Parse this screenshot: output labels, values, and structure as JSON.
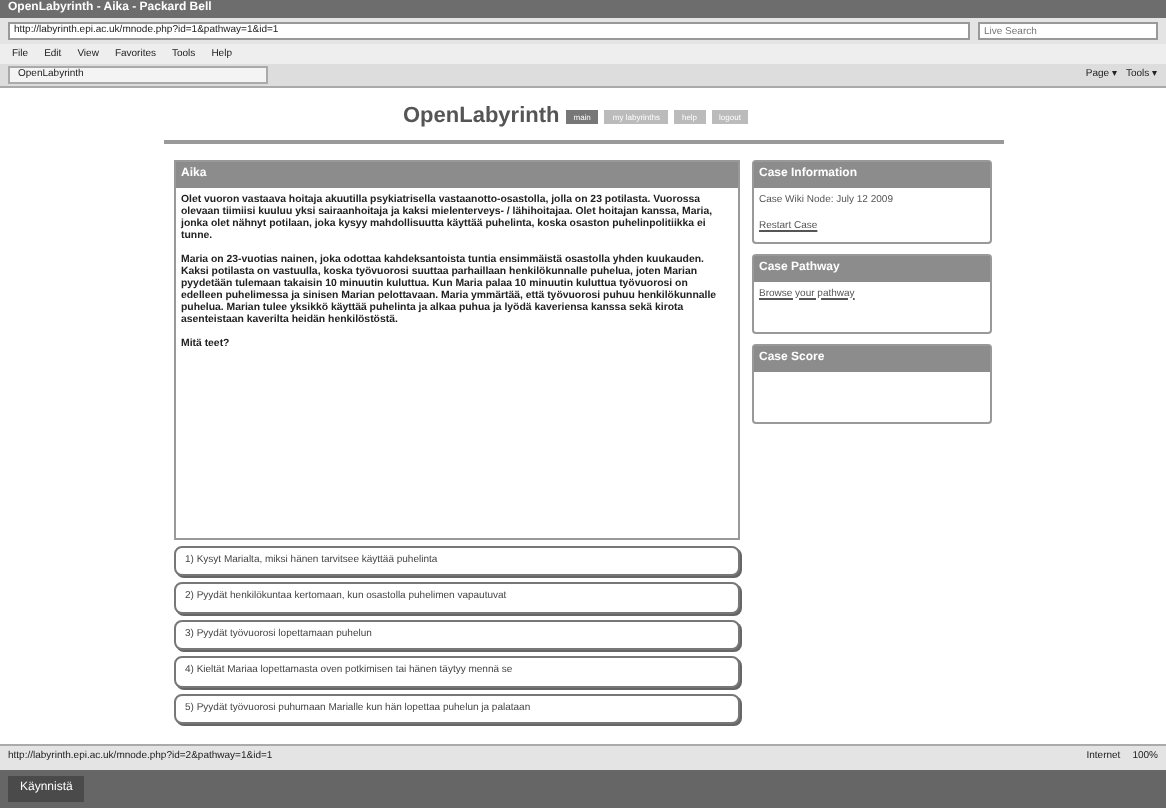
{
  "window": {
    "title": "OpenLabyrinth - Aika - Packard Bell"
  },
  "browser": {
    "address": "http://labyrinth.epi.ac.uk/mnode.php?id=1&pathway=1&id=1",
    "search_placeholder": "Live Search",
    "menu": [
      "File",
      "Edit",
      "View",
      "Favorites",
      "Tools",
      "Help"
    ],
    "tab": "OpenLabyrinth",
    "tools": [
      "Page ▾",
      "Tools ▾"
    ]
  },
  "site": {
    "logo": "OpenLabyrinth",
    "nav": [
      {
        "label": "main",
        "selected": true
      },
      {
        "label": "my labyrinths",
        "selected": false
      },
      {
        "label": "help",
        "selected": false
      },
      {
        "label": "logout",
        "selected": false
      }
    ]
  },
  "node": {
    "title": "Aika",
    "paragraphs": [
      "Olet vuoron vastaava hoitaja akuutilla psykiatrisella vastaanotto-osastolla, jolla on 23 potilasta. Vuorossa olevaan tiimiisi kuuluu yksi sairaanhoitaja ja kaksi mielenterveys- / lähihoitajaa. Olet hoitajan kanssa, Maria, jonka olet nähnyt potilaan, joka kysyy mahdollisuutta käyttää puhelinta, koska osaston puhelinpolitiikka ei tunne.",
      "Maria on 23-vuotias nainen, joka odottaa kahdeksantoista tuntia ensimmäistä osastolla yhden kuukauden. Kaksi potilasta on vastuulla, koska työvuorosi suuttaa parhaillaan henkilökunnalle puhelua, joten Marian pyydetään tulemaan takaisin 10 minuutin kuluttua. Kun Maria palaa 10 minuutin kuluttua työvuorosi on edelleen puhelimessa ja sinisen Marian pelottavaan. Maria ymmärtää, että työvuorosi puhuu henkilökunnalle puhelua. Marian tulee yksikkö käyttää puhelinta ja alkaa puhua ja lyödä kaveriensa kanssa sekä kirota asenteistaan kaverilta heidän henkilöstöstä.",
      "Mitä teet?"
    ],
    "options": [
      "1) Kysyt Marialta, miksi hänen tarvitsee käyttää puhelinta",
      "2) Pyydät henkilökuntaa kertomaan, kun osastolla puhelimen vapautuvat",
      "3) Pyydät työvuorosi lopettamaan puhelun",
      "4) Kieltät Mariaa lopettamasta oven potkimisen tai hänen täytyy mennä se",
      "5) Pyydät työvuorosi puhumaan Marialle kun hän lopettaa puhelun ja palataan"
    ]
  },
  "sidebar": [
    {
      "title": "Case Information",
      "lines": [
        "Case Wiki Node: July 12 2009"
      ],
      "link": "Restart Case"
    },
    {
      "title": "Case Pathway",
      "link": "Browse your pathway"
    },
    {
      "title": "Case Score"
    }
  ],
  "status": {
    "url": "http://labyrinth.epi.ac.uk/mnode.php?id=2&pathway=1&id=1",
    "zone": "Internet",
    "zoom": "100%"
  },
  "taskbar": {
    "start": "Käynnistä"
  }
}
